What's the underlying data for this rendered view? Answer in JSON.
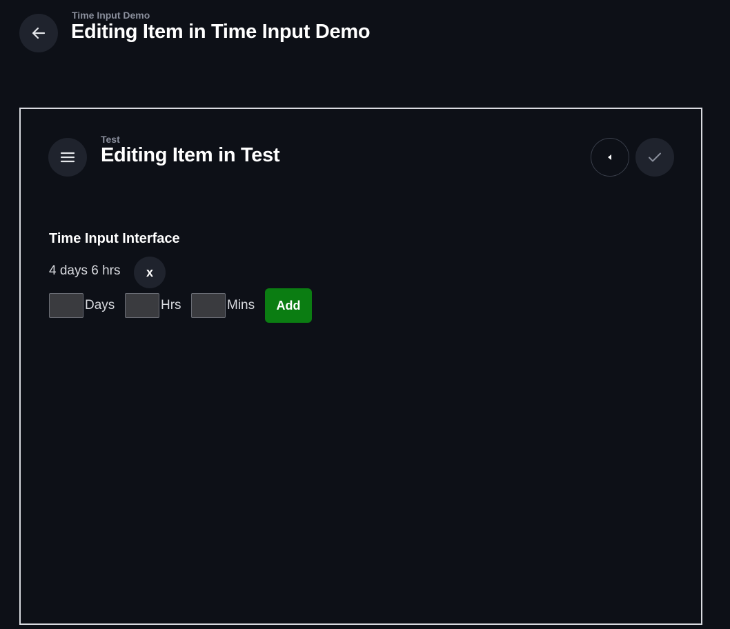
{
  "header": {
    "breadcrumb": "Time Input Demo",
    "title": "Editing Item in Time Input Demo",
    "back_icon": "arrow-left-icon"
  },
  "panel": {
    "breadcrumb": "Test",
    "title": "Editing Item in Test",
    "menu_icon": "menu-icon",
    "prev_icon": "caret-left-icon",
    "save_icon": "check-icon"
  },
  "field": {
    "label": "Time Input Interface",
    "current_value": "4 days 6 hrs",
    "clear_label": "x",
    "inputs": {
      "days": {
        "value": "",
        "unit": "Days"
      },
      "hrs": {
        "value": "",
        "unit": "Hrs"
      },
      "mins": {
        "value": "",
        "unit": "Mins"
      }
    },
    "add_label": "Add"
  },
  "colors": {
    "background": "#0d1017",
    "button_bg": "#1f232d",
    "add_button": "#0b7d12",
    "frame_border": "#d9dbe0"
  }
}
